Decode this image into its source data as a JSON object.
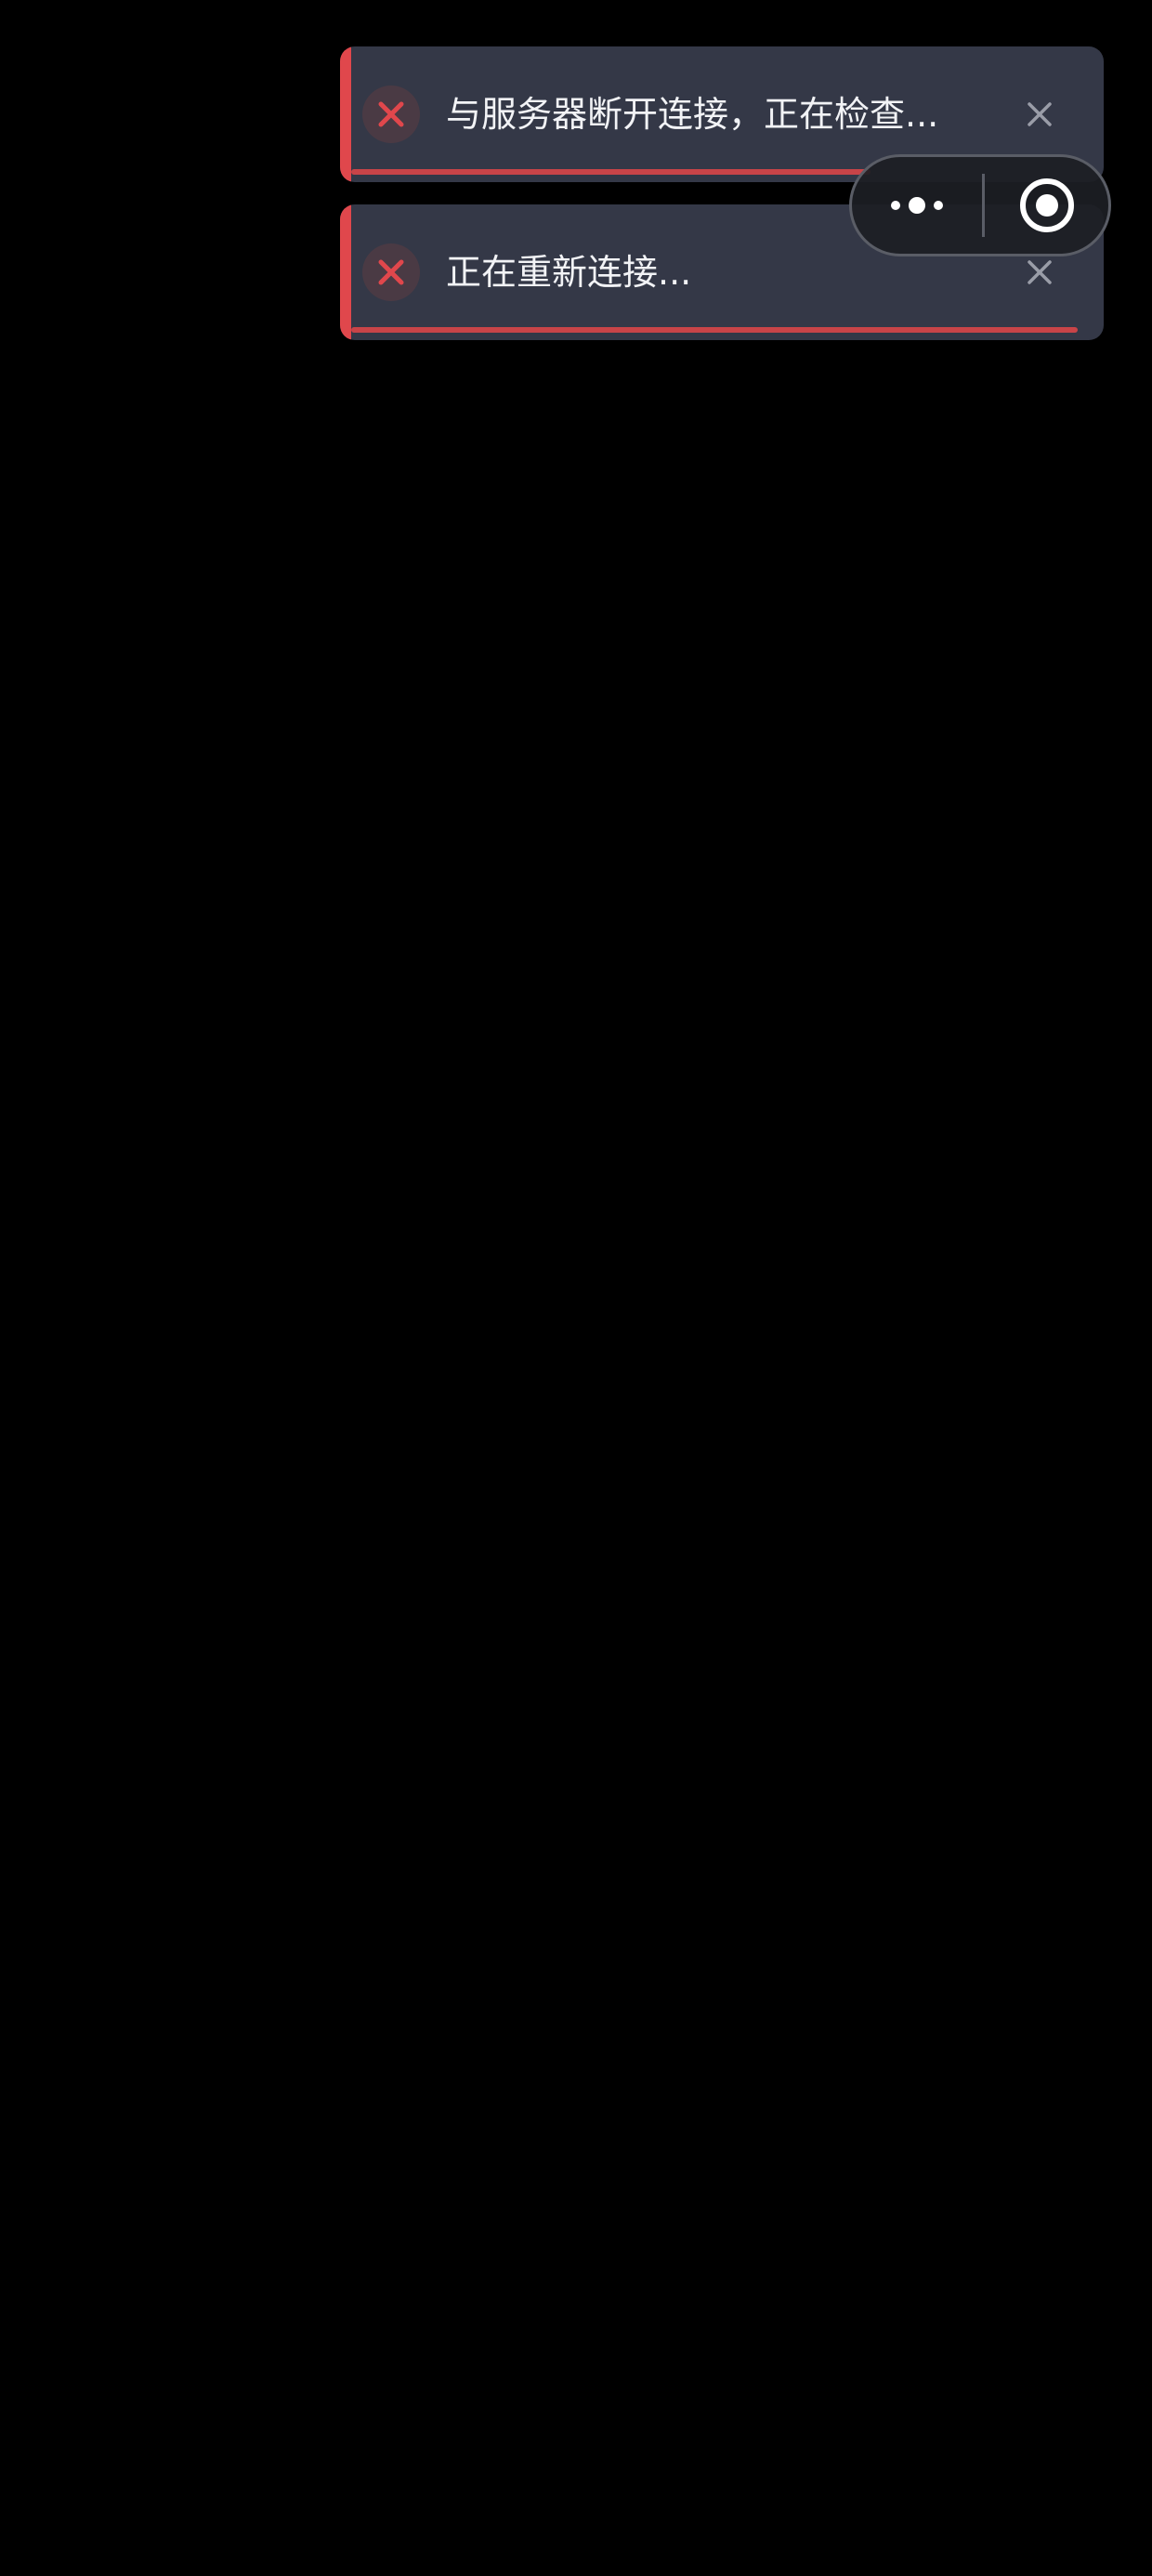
{
  "colors": {
    "background": "#000000",
    "toast_background": "#343847",
    "error_accent": "#e0474c",
    "icon_circle": "#4a3a44",
    "text": "#f2f3f6",
    "close_icon": "#9a9da8",
    "progress": "#c94448",
    "capsule_border": "#5a5d66"
  },
  "toasts": [
    {
      "type": "error",
      "icon": "error-x-icon",
      "message": "与服务器断开连接，正在检查...",
      "close_icon": "close-icon",
      "remaining_fraction": 0.7
    },
    {
      "type": "error",
      "icon": "error-x-icon",
      "message": "正在重新连接...",
      "close_icon": "close-icon",
      "remaining_fraction": 0.98
    }
  ],
  "capsule": {
    "more_icon": "more-dots-icon",
    "close_icon": "target-circle-icon"
  }
}
